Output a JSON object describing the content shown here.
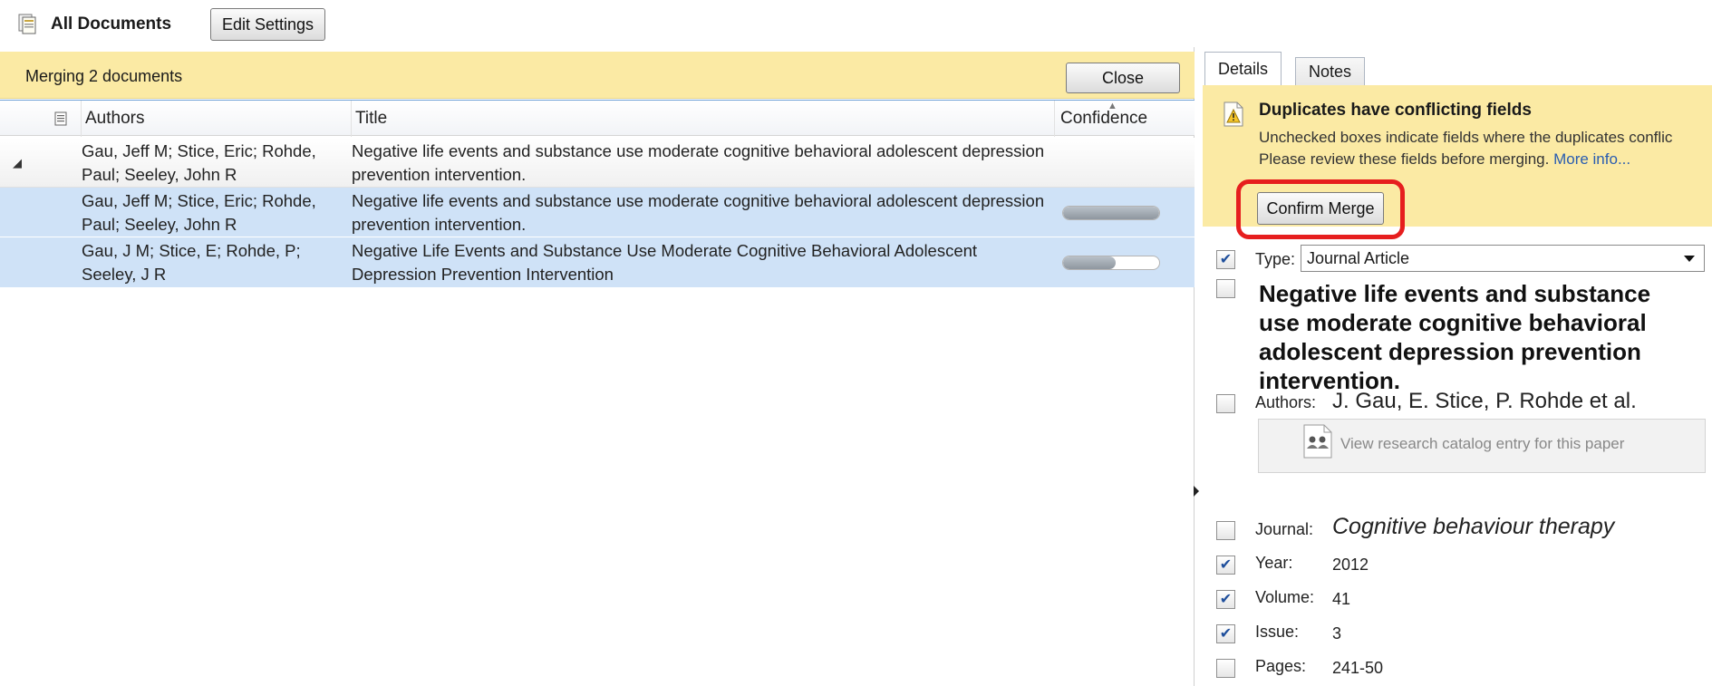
{
  "toolbar": {
    "title": "All Documents",
    "edit_settings_label": "Edit Settings"
  },
  "merge_bar": {
    "text": "Merging 2 documents",
    "close_label": "Close"
  },
  "table": {
    "columns": [
      "Authors",
      "Title",
      "Confidence"
    ],
    "rows": [
      {
        "authors": "Gau, Jeff M; Stice, Eric; Rohde, Paul; Seeley, John R",
        "title": "Negative life events and substance use moderate cognitive behavioral adolescent depression prevention intervention.",
        "confidence": null,
        "expanded": true
      },
      {
        "authors": "Gau, Jeff M; Stice, Eric; Rohde, Paul; Seeley, John R",
        "title": "Negative life events and substance use moderate cognitive behavioral adolescent depression prevention intervention.",
        "confidence": 1.0
      },
      {
        "authors": "Gau, J M; Stice, E; Rohde, P; Seeley, J R",
        "title": "Negative Life Events and Substance Use Moderate Cognitive Behavioral Adolescent Depression Prevention Intervention",
        "confidence": 0.55
      }
    ]
  },
  "details": {
    "tabs": [
      "Details",
      "Notes"
    ],
    "active_tab": "Details",
    "warning": {
      "title": "Duplicates have conflicting fields",
      "line1": "Unchecked boxes indicate fields where the duplicates conflic",
      "line2": "Please review these fields before merging.",
      "link": "More info..."
    },
    "confirm_merge_label": "Confirm Merge",
    "type_label": "Type:",
    "type_value": "Journal Article",
    "doc_title": "Negative life events and substance use moderate cognitive behavioral adolescent depression prevention intervention.",
    "authors_label": "Authors:",
    "authors_value": "J. Gau, E. Stice, P. Rohde et al.",
    "catalog_text": "View research catalog entry for this paper",
    "journal_label": "Journal:",
    "journal_value": "Cognitive behaviour therapy",
    "year_label": "Year:",
    "year_value": "2012",
    "volume_label": "Volume:",
    "volume_value": "41",
    "issue_label": "Issue:",
    "issue_value": "3",
    "pages_label": "Pages:",
    "pages_value": "241-50",
    "checked": {
      "type": true,
      "title": false,
      "authors": false,
      "journal": false,
      "year": true,
      "volume": true,
      "issue": true,
      "pages": false
    }
  },
  "colors": {
    "merge_bar": "#fbeaa4",
    "selected_row": "#cfe2f7",
    "highlight_ring": "#e61e1e",
    "link": "#2a5db0"
  }
}
